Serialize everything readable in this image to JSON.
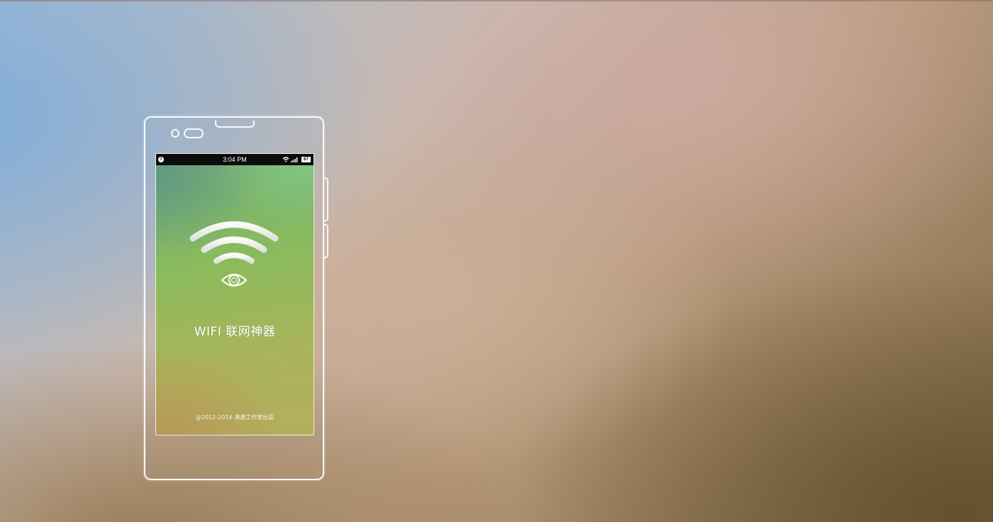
{
  "status_bar": {
    "alert": "!",
    "time": "3:04 PM",
    "battery": "67"
  },
  "app": {
    "title": "WIFI 联网神器",
    "copyright": "@2012-2014 满通工作室出品"
  },
  "icons": {
    "logo": "wifi-eye-icon",
    "wifi": "wifi-icon",
    "signal": "signal-bars-icon",
    "battery": "battery-icon"
  },
  "colors": {
    "status_bar_bg": "#0c0c0c",
    "screen_top": "#73b07a",
    "screen_bottom": "#b4ae5e",
    "outline": "#ffffff"
  }
}
